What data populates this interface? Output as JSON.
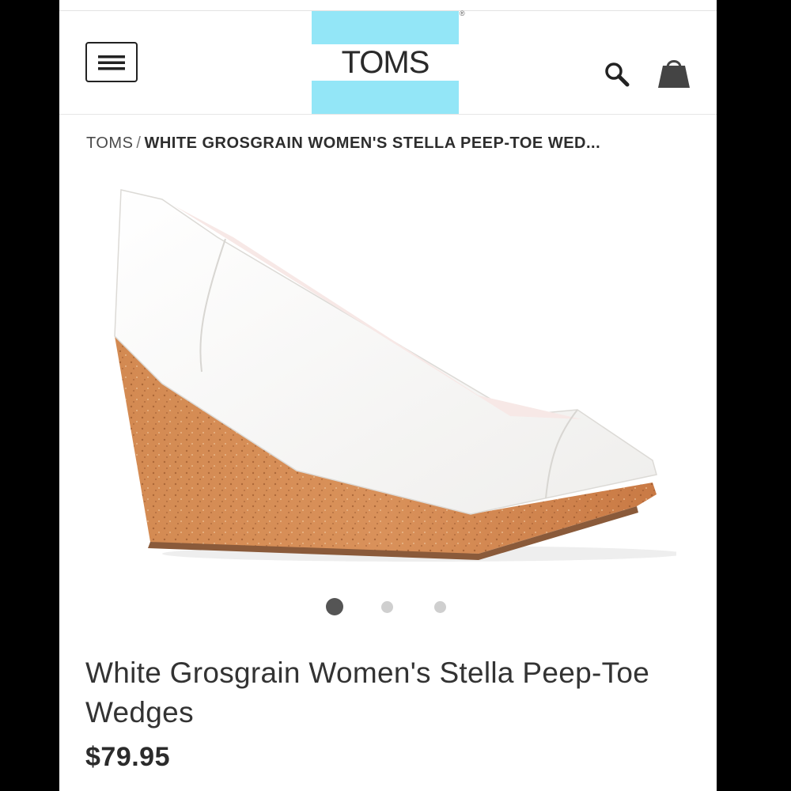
{
  "header": {
    "menu_icon": "hamburger-menu-icon",
    "logo_text": "TOMS",
    "logo_colors": {
      "band": "#93e6f7",
      "text": "#2a2a2a"
    },
    "search_icon": "search-icon",
    "cart_icon": "shopping-bag-icon"
  },
  "breadcrumb": {
    "home": "TOMS",
    "separator": "/",
    "current": "WHITE GROSGRAIN WOMEN'S STELLA PEEP-TOE WED..."
  },
  "gallery": {
    "image_subject": "white peep-toe wedge shoe with cork heel",
    "total_images": 3,
    "active_index": 1
  },
  "product": {
    "title": "White Grosgrain Women's Stella Peep-Toe Wedges",
    "price": "$79.95"
  }
}
